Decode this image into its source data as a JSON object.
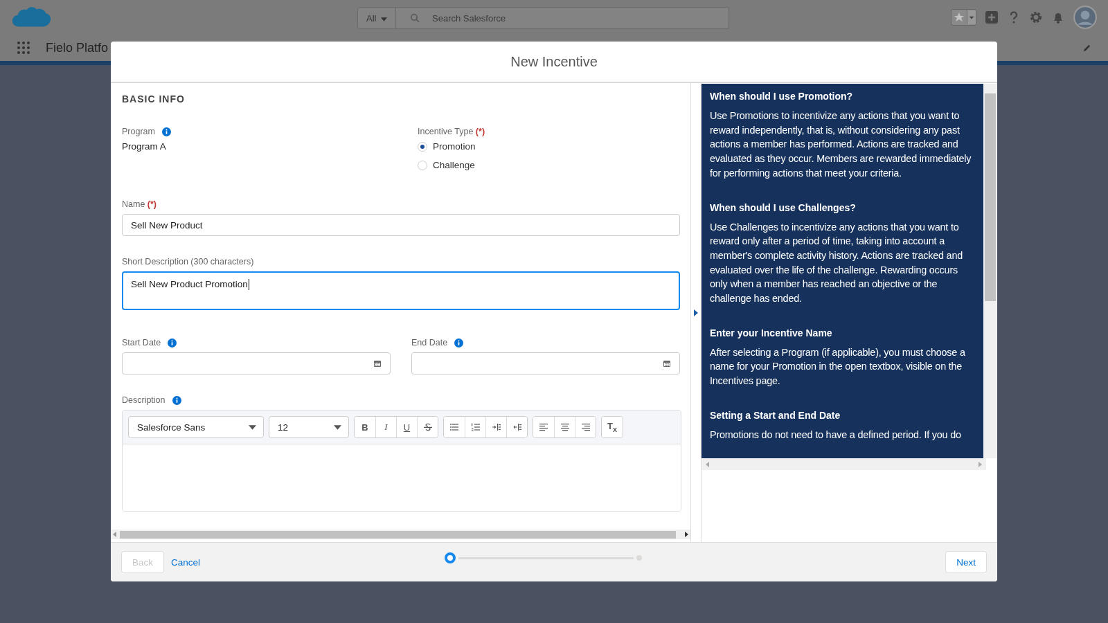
{
  "top_bar": {
    "search_scope": "All",
    "search_placeholder": "Search Salesforce",
    "app_name": "Fielo Platfo"
  },
  "modal": {
    "title": "New Incentive"
  },
  "form": {
    "section": "BASIC INFO",
    "program": {
      "label": "Program",
      "value": "Program A",
      "info": true
    },
    "incentive_type": {
      "label": "Incentive Type",
      "required_mark": "(*)",
      "options": [
        {
          "label": "Promotion",
          "selected": true
        },
        {
          "label": "Challenge",
          "selected": false
        }
      ]
    },
    "name": {
      "label": "Name",
      "required_mark": "(*)",
      "value": "Sell New Product"
    },
    "short_description": {
      "label": "Short Description (300 characters)",
      "value": "Sell New Product Promotion",
      "focused": true
    },
    "start_date": {
      "label": "Start Date",
      "info": true
    },
    "end_date": {
      "label": "End Date",
      "info": true
    },
    "description": {
      "label": "Description",
      "info": true,
      "font": "Salesforce Sans",
      "size": "12",
      "tool_groups": [
        [
          {
            "kind": "bold",
            "label": "B"
          },
          {
            "kind": "italic",
            "label": "I"
          },
          {
            "kind": "underline",
            "label": "U"
          },
          {
            "kind": "strike"
          }
        ],
        [
          {
            "kind": "bullets"
          },
          {
            "kind": "numbers"
          },
          {
            "kind": "indent"
          },
          {
            "kind": "outdent"
          }
        ],
        [
          {
            "kind": "align-left"
          },
          {
            "kind": "align-center"
          },
          {
            "kind": "align-right"
          }
        ],
        [
          {
            "kind": "clear",
            "label": "T$_{x}$"
          }
        ]
      ]
    }
  },
  "help": [
    {
      "heading": "When should I use Promotion?",
      "text": "Use Promotions to incentivize any actions that you want to reward independently, that is, without considering any past actions a member has performed. Actions are tracked and evaluated as they occur. Members are rewarded immediately for performing actions that meet your criteria."
    },
    {
      "heading": "When should I use Challenges?",
      "text": "Use Challenges to incentivize any actions that you want to reward only after a period of time, taking into account a member's complete activity history. Actions are tracked and evaluated over the life of the challenge. Rewarding occurs only when a member has reached an objective or the challenge has ended."
    },
    {
      "heading": "Enter your Incentive Name",
      "text": "After selecting a Program (if applicable), you must choose a name for your Promotion in the open textbox, visible on the Incentives page."
    },
    {
      "heading": "Setting a Start and End Date",
      "text": "Promotions do not need to have a defined period. If you do"
    }
  ],
  "footer": {
    "back": {
      "label": "Back",
      "disabled": true
    },
    "cancel": "Cancel",
    "steps": [
      {
        "selected": true
      },
      {
        "selected": false
      }
    ],
    "next": "Next"
  }
}
